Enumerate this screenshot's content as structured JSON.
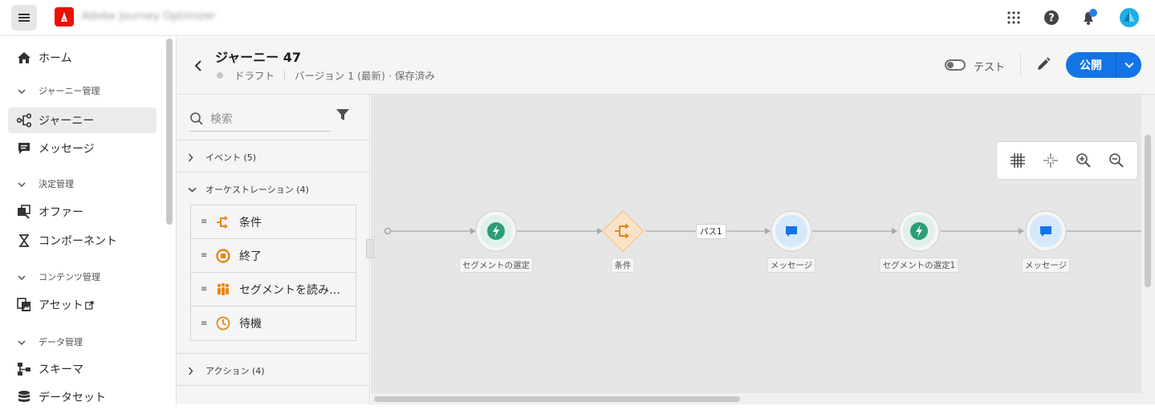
{
  "app": {
    "title": "Adobe Journey Optimizer"
  },
  "nav": {
    "home": "ホーム",
    "section_journey_mgmt": "ジャーニー管理",
    "journeys": "ジャーニー",
    "messages": "メッセージ",
    "section_decision_mgmt": "決定管理",
    "offers": "オファー",
    "components": "コンポーネント",
    "section_content_mgmt": "コンテンツ管理",
    "assets": "アセット",
    "section_data_mgmt": "データ管理",
    "schemas": "スキーマ",
    "datasets": "データセット"
  },
  "header": {
    "title": "ジャーニー 47",
    "status": "ドラフト",
    "version": "バージョン 1 (最新) · 保存済み",
    "test_label": "テスト",
    "publish_label": "公開"
  },
  "palette": {
    "search_placeholder": "検索",
    "events": "イベント (5)",
    "orchestration": "オーケストレーション (4)",
    "actions": "アクション (4)",
    "items": [
      {
        "label": "条件",
        "icon": "condition-icon",
        "color": "#e68619"
      },
      {
        "label": "終了",
        "icon": "end-icon",
        "color": "#e68619"
      },
      {
        "label": "セグメントを読み…",
        "icon": "read-segment-icon",
        "color": "#e68619"
      },
      {
        "label": "待機",
        "icon": "wait-icon",
        "color": "#e68619"
      }
    ]
  },
  "canvas": {
    "nodes": [
      {
        "label": "セグメントの選定",
        "type": "event",
        "icon": "lightning-icon"
      },
      {
        "label": "条件",
        "type": "condition",
        "icon": "condition-icon"
      },
      {
        "label": "メッセージ",
        "type": "message",
        "icon": "chat-icon"
      },
      {
        "label": "セグメントの選定1",
        "type": "event",
        "icon": "lightning-icon"
      },
      {
        "label": "メッセージ",
        "type": "message",
        "icon": "chat-icon"
      }
    ],
    "path_label": "パス1"
  },
  "colors": {
    "accent": "#1473e6",
    "event_green": "#2d9d78",
    "event_bg": "#e6f3ef",
    "message_blue": "#1473e6",
    "message_bg": "#d6e8fb",
    "orchestration_orange": "#e68619"
  }
}
